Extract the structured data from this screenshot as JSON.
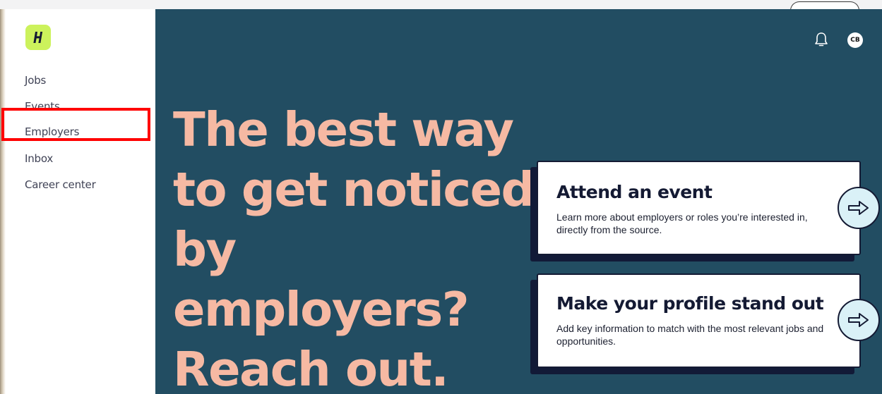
{
  "sidebar": {
    "logo_letter": "H",
    "items": [
      {
        "label": "Jobs"
      },
      {
        "label": "Events"
      },
      {
        "label": "Employers"
      },
      {
        "label": "Inbox"
      },
      {
        "label": "Career center"
      }
    ]
  },
  "header": {
    "bell_icon": "bell-icon",
    "avatar_initials": "CB"
  },
  "hero": {
    "headline": "The best way to get noticed by employers? Reach out."
  },
  "cards": [
    {
      "title": "Attend an event",
      "description": "Learn more about employers or roles you’re interested in, directly from the source.",
      "icon": "arrow-right-icon"
    },
    {
      "title": "Make your profile stand out",
      "description": "Add key information to match with the most relevant jobs and opportunities.",
      "icon": "arrow-right-icon"
    }
  ],
  "colors": {
    "main_background": "#224d62",
    "headline": "#f6b9a3",
    "logo_background": "#ccf25c",
    "card_shadow": "#121a37",
    "arrow_button": "#daf1f7",
    "highlight_box": "#ff0000"
  }
}
